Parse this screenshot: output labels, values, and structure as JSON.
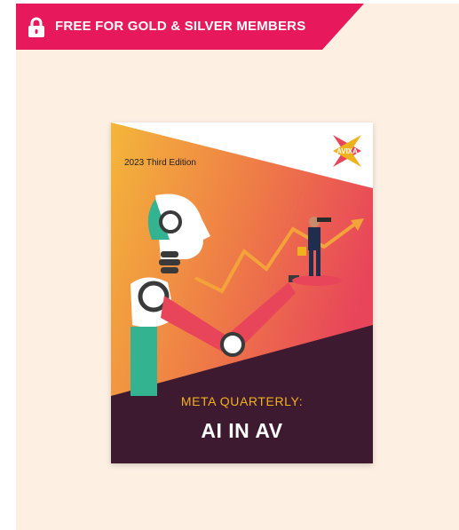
{
  "banner": {
    "label": "FREE FOR GOLD & SILVER MEMBERS",
    "color": "#e8185c"
  },
  "cover": {
    "edition": "2023 Third Edition",
    "series": "META QUARTERLY:",
    "title": "AI IN AV",
    "logo": "AVIXA",
    "colors": {
      "background": "#fdf0e3",
      "gradient_start": "#f4b63a",
      "gradient_end": "#e8455a",
      "band": "#3d1a30",
      "accent_gold": "#f0b21c"
    }
  }
}
